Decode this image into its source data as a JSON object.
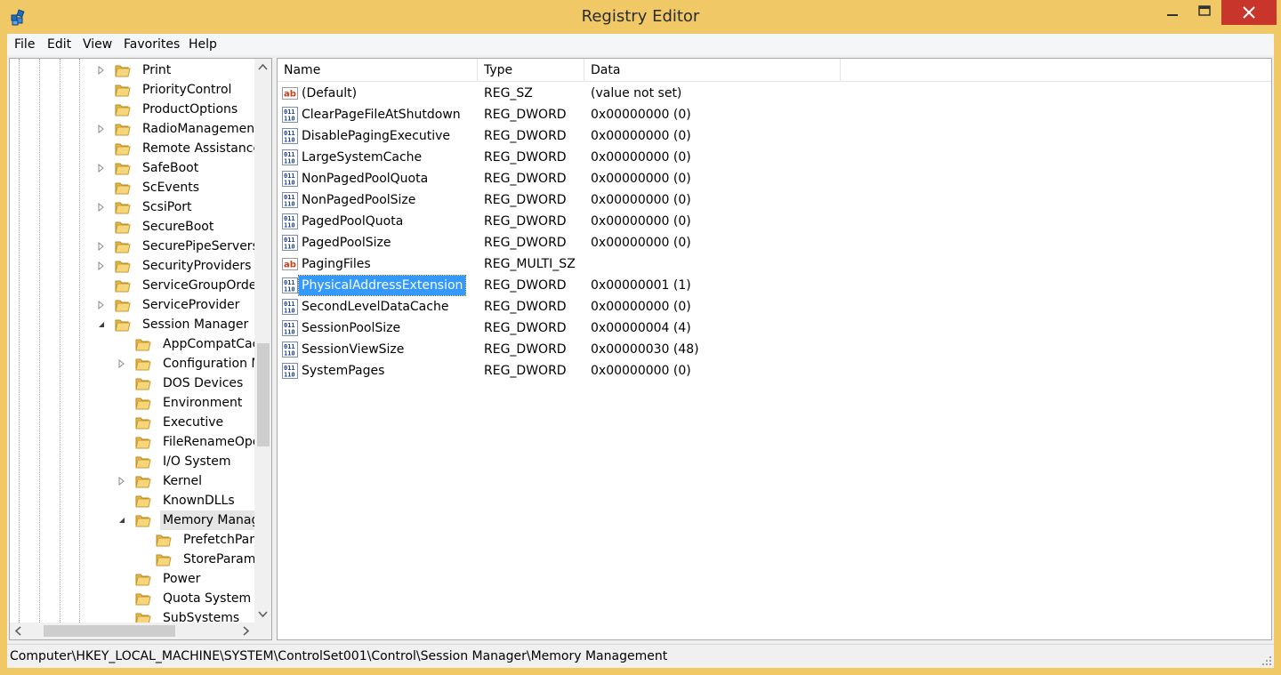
{
  "window": {
    "title": "Registry Editor",
    "icon": "registry-icon",
    "frame_color": "#f0c865",
    "close_color": "#c7352b"
  },
  "menu": {
    "items": [
      {
        "label": "File"
      },
      {
        "label": "Edit"
      },
      {
        "label": "View"
      },
      {
        "label": "Favorites"
      },
      {
        "label": "Help"
      }
    ]
  },
  "tree": {
    "items": [
      {
        "label": "Print",
        "expander": "collapsed",
        "level": 0
      },
      {
        "label": "PriorityControl",
        "expander": "none",
        "level": 0
      },
      {
        "label": "ProductOptions",
        "expander": "none",
        "level": 0
      },
      {
        "label": "RadioManagement",
        "expander": "collapsed",
        "level": 0
      },
      {
        "label": "Remote Assistance",
        "expander": "none",
        "level": 0
      },
      {
        "label": "SafeBoot",
        "expander": "collapsed",
        "level": 0
      },
      {
        "label": "ScEvents",
        "expander": "none",
        "level": 0
      },
      {
        "label": "ScsiPort",
        "expander": "collapsed",
        "level": 0
      },
      {
        "label": "SecureBoot",
        "expander": "none",
        "level": 0
      },
      {
        "label": "SecurePipeServers",
        "expander": "collapsed",
        "level": 0
      },
      {
        "label": "SecurityProviders",
        "expander": "collapsed",
        "level": 0
      },
      {
        "label": "ServiceGroupOrder",
        "expander": "none",
        "level": 0
      },
      {
        "label": "ServiceProvider",
        "expander": "collapsed",
        "level": 0
      },
      {
        "label": "Session Manager",
        "expander": "expanded",
        "level": 0
      },
      {
        "label": "AppCompatCache",
        "expander": "none",
        "level": 1
      },
      {
        "label": "Configuration Manager",
        "expander": "collapsed",
        "level": 1
      },
      {
        "label": "DOS Devices",
        "expander": "none",
        "level": 1
      },
      {
        "label": "Environment",
        "expander": "none",
        "level": 1
      },
      {
        "label": "Executive",
        "expander": "none",
        "level": 1
      },
      {
        "label": "FileRenameOperations",
        "expander": "none",
        "level": 1
      },
      {
        "label": "I/O System",
        "expander": "none",
        "level": 1
      },
      {
        "label": "Kernel",
        "expander": "collapsed",
        "level": 1
      },
      {
        "label": "KnownDLLs",
        "expander": "none",
        "level": 1
      },
      {
        "label": "Memory Management",
        "expander": "expanded",
        "level": 1,
        "selected": true
      },
      {
        "label": "PrefetchParameters",
        "expander": "none",
        "level": 2
      },
      {
        "label": "StoreParameters",
        "expander": "none",
        "level": 2
      },
      {
        "label": "Power",
        "expander": "none",
        "level": 1
      },
      {
        "label": "Quota System",
        "expander": "none",
        "level": 1
      },
      {
        "label": "SubSystems",
        "expander": "none",
        "level": 1
      }
    ]
  },
  "list": {
    "columns": [
      {
        "label": "Name"
      },
      {
        "label": "Type"
      },
      {
        "label": "Data"
      }
    ],
    "rows": [
      {
        "name": "(Default)",
        "type": "REG_SZ",
        "data": "(value not set)",
        "icon": "string-value-icon"
      },
      {
        "name": "ClearPageFileAtShutdown",
        "type": "REG_DWORD",
        "data": "0x00000000 (0)",
        "icon": "binary-value-icon"
      },
      {
        "name": "DisablePagingExecutive",
        "type": "REG_DWORD",
        "data": "0x00000000 (0)",
        "icon": "binary-value-icon"
      },
      {
        "name": "LargeSystemCache",
        "type": "REG_DWORD",
        "data": "0x00000000 (0)",
        "icon": "binary-value-icon"
      },
      {
        "name": "NonPagedPoolQuota",
        "type": "REG_DWORD",
        "data": "0x00000000 (0)",
        "icon": "binary-value-icon"
      },
      {
        "name": "NonPagedPoolSize",
        "type": "REG_DWORD",
        "data": "0x00000000 (0)",
        "icon": "binary-value-icon"
      },
      {
        "name": "PagedPoolQuota",
        "type": "REG_DWORD",
        "data": "0x00000000 (0)",
        "icon": "binary-value-icon"
      },
      {
        "name": "PagedPoolSize",
        "type": "REG_DWORD",
        "data": "0x00000000 (0)",
        "icon": "binary-value-icon"
      },
      {
        "name": "PagingFiles",
        "type": "REG_MULTI_SZ",
        "data": "",
        "icon": "string-value-icon"
      },
      {
        "name": "PhysicalAddressExtension",
        "type": "REG_DWORD",
        "data": "0x00000001 (1)",
        "icon": "binary-value-icon",
        "selected": true
      },
      {
        "name": "SecondLevelDataCache",
        "type": "REG_DWORD",
        "data": "0x00000000 (0)",
        "icon": "binary-value-icon"
      },
      {
        "name": "SessionPoolSize",
        "type": "REG_DWORD",
        "data": "0x00000004 (4)",
        "icon": "binary-value-icon"
      },
      {
        "name": "SessionViewSize",
        "type": "REG_DWORD",
        "data": "0x00000030 (48)",
        "icon": "binary-value-icon"
      },
      {
        "name": "SystemPages",
        "type": "REG_DWORD",
        "data": "0x00000000 (0)",
        "icon": "binary-value-icon"
      }
    ]
  },
  "status": {
    "path": "Computer\\HKEY_LOCAL_MACHINE\\SYSTEM\\ControlSet001\\Control\\Session Manager\\Memory Management"
  }
}
